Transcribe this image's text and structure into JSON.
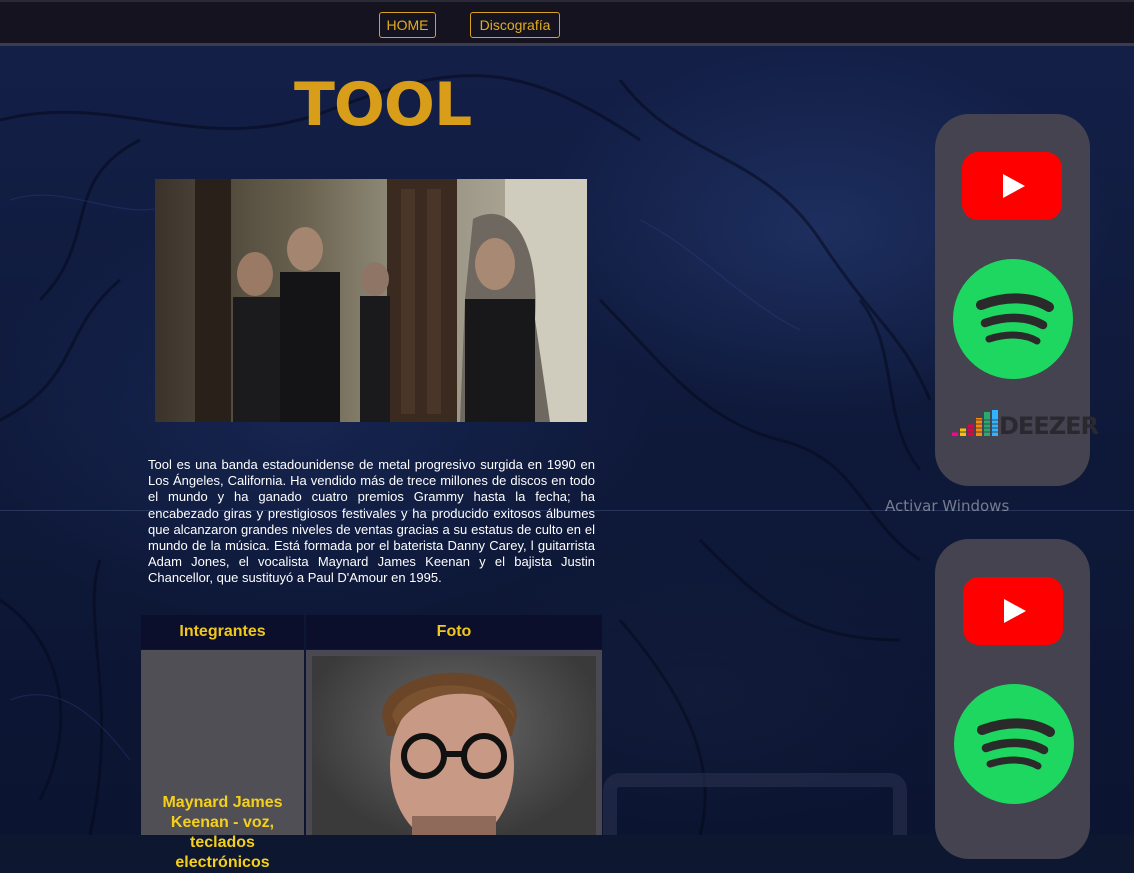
{
  "nav": {
    "home_label": "HOME",
    "discography_label": "Discografía"
  },
  "page": {
    "title": "TOOL"
  },
  "description": "Tool es una banda estadounidense de metal progresivo surgida en 1990 en Los Ángeles, California. Ha vendido más de trece millones de discos en todo el mundo y ha ganado cuatro premios Grammy hasta la fecha; ha encabezado giras y prestigiosos festivales y ha producido exitosos álbumes que alcanzaron grandes niveles de ventas gracias a su estatus de culto en el mundo de la música. Está formada por el baterista Danny Carey, l guitarrista Adam Jones, el vocalista Maynard James Keenan y el bajista Justin Chancellor, que sustituyó a Paul D'Amour en 1995.",
  "members_table": {
    "headers": [
      "Integrantes",
      "Foto"
    ],
    "rows": [
      {
        "name": "Maynard James Keenan - voz, teclados electrónicos"
      }
    ]
  },
  "streaming": {
    "deezer_label": "DEEZER",
    "icons": [
      "youtube-icon",
      "spotify-icon",
      "deezer-icon"
    ]
  },
  "os_watermark": "Activar Windows",
  "colors": {
    "accent": "#d89e19",
    "nav_border": "#d9a21e",
    "table_header_text": "#f0c81a",
    "youtube": "#ff0000",
    "spotify": "#1ed760",
    "panel": "#44434f"
  }
}
